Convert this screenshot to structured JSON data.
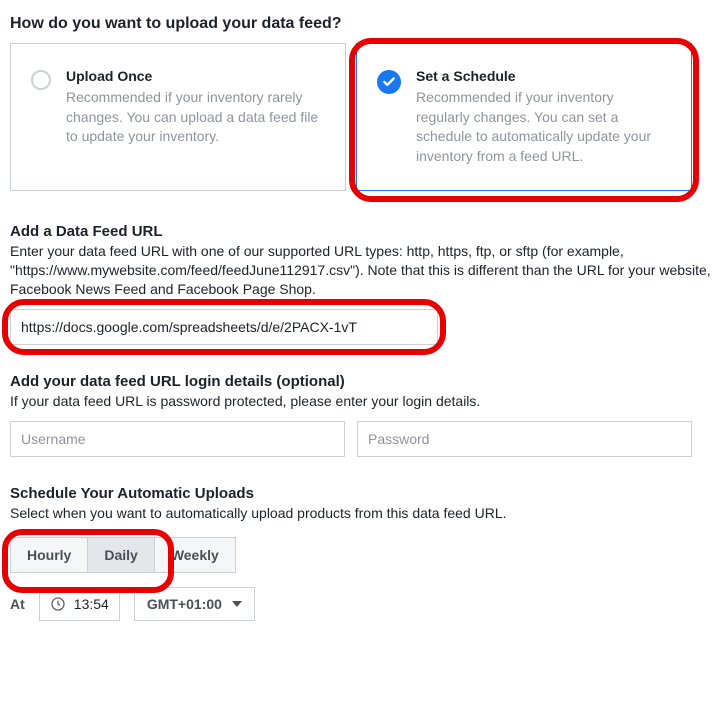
{
  "heading": "How do you want to upload your data feed?",
  "options": {
    "once": {
      "title": "Upload Once",
      "desc": "Recommended if your inventory rarely changes. You can upload a data feed file to update your inventory."
    },
    "schedule": {
      "title": "Set a Schedule",
      "desc": "Recommended if your inventory regularly changes. You can set a schedule to automatically update your inventory from a feed URL."
    }
  },
  "feed_url": {
    "title": "Add a Data Feed URL",
    "desc": "Enter your data feed URL with one of our supported URL types: http, https, ftp, or sftp (for example, \"https://www.mywebsite.com/feed/feedJune112917.csv\"). Note that this is different than the URL for your website, Facebook News Feed and Facebook Page Shop.",
    "value": "https://docs.google.com/spreadsheets/d/e/2PACX-1vT"
  },
  "login": {
    "title": "Add your data feed URL login details (optional)",
    "desc": "If your data feed URL is password protected, please enter your login details.",
    "username_placeholder": "Username",
    "password_placeholder": "Password"
  },
  "schedule": {
    "title": "Schedule Your Automatic Uploads",
    "desc": "Select when you want to automatically upload products from this data feed URL.",
    "freq": {
      "hourly": "Hourly",
      "daily": "Daily",
      "weekly": "Weekly"
    },
    "at_label": "At",
    "time": "13:54",
    "timezone": "GMT+01:00"
  }
}
